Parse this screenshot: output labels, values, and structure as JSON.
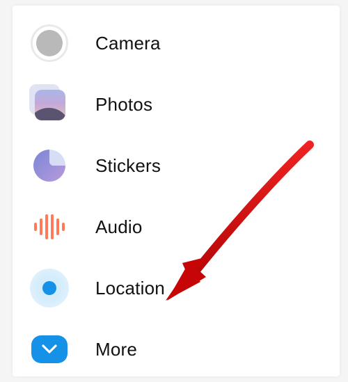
{
  "menu": {
    "items": [
      {
        "key": "camera",
        "label": "Camera",
        "icon": "camera-icon"
      },
      {
        "key": "photos",
        "label": "Photos",
        "icon": "photos-icon"
      },
      {
        "key": "stickers",
        "label": "Stickers",
        "icon": "stickers-icon"
      },
      {
        "key": "audio",
        "label": "Audio",
        "icon": "audio-icon"
      },
      {
        "key": "location",
        "label": "Location",
        "icon": "location-icon"
      },
      {
        "key": "more",
        "label": "More",
        "icon": "more-icon"
      }
    ]
  },
  "annotation": {
    "target": "location",
    "color": "#d40808"
  }
}
